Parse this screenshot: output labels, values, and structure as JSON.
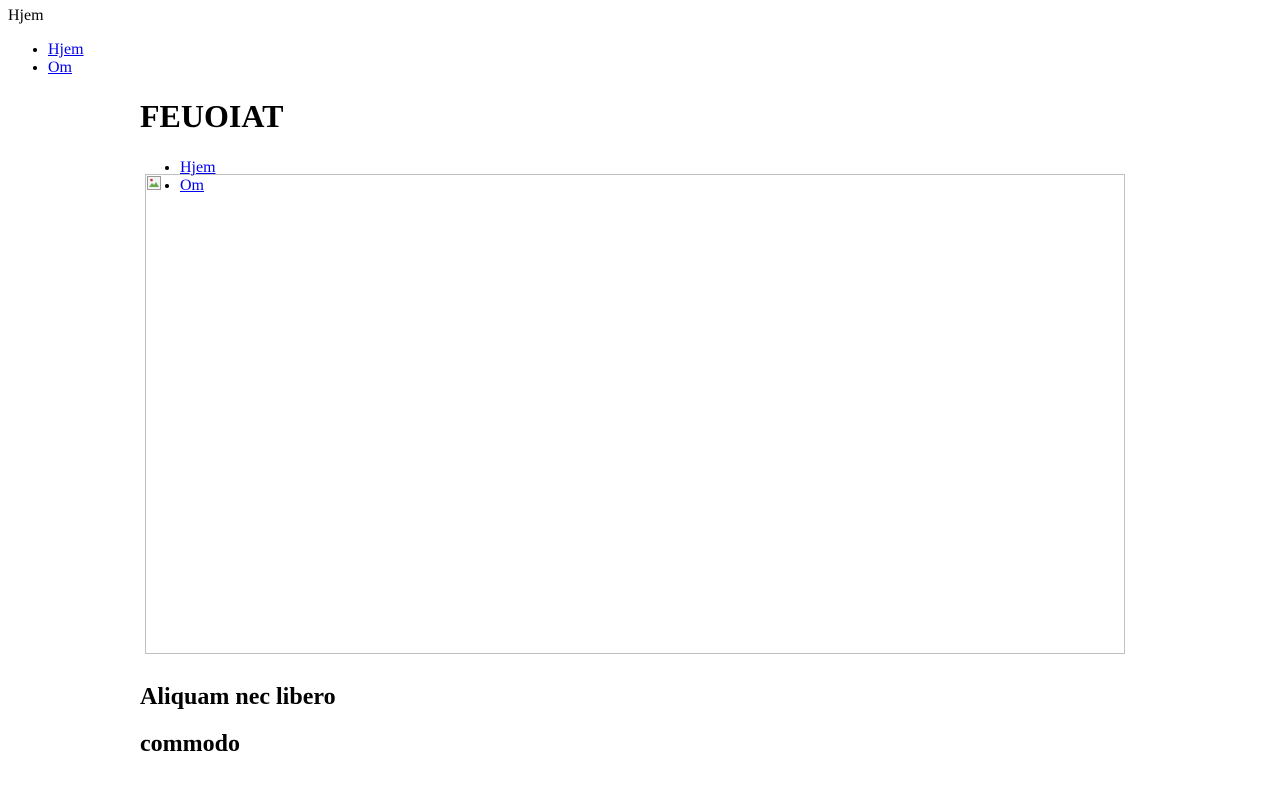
{
  "header": {
    "label": "Hjem"
  },
  "top_nav": {
    "items": [
      {
        "label": "Hjem"
      },
      {
        "label": "Om"
      }
    ]
  },
  "main": {
    "title": "FEUOIAT",
    "inner_nav": {
      "items": [
        {
          "label": "Hjem"
        },
        {
          "label": "Om"
        }
      ]
    },
    "headings": [
      "Aliquam nec libero",
      "commodo"
    ]
  },
  "colors": {
    "link": "#0000ee",
    "image_border": "#c0c0c0"
  },
  "icons": {
    "broken_image": "broken-image-icon"
  }
}
